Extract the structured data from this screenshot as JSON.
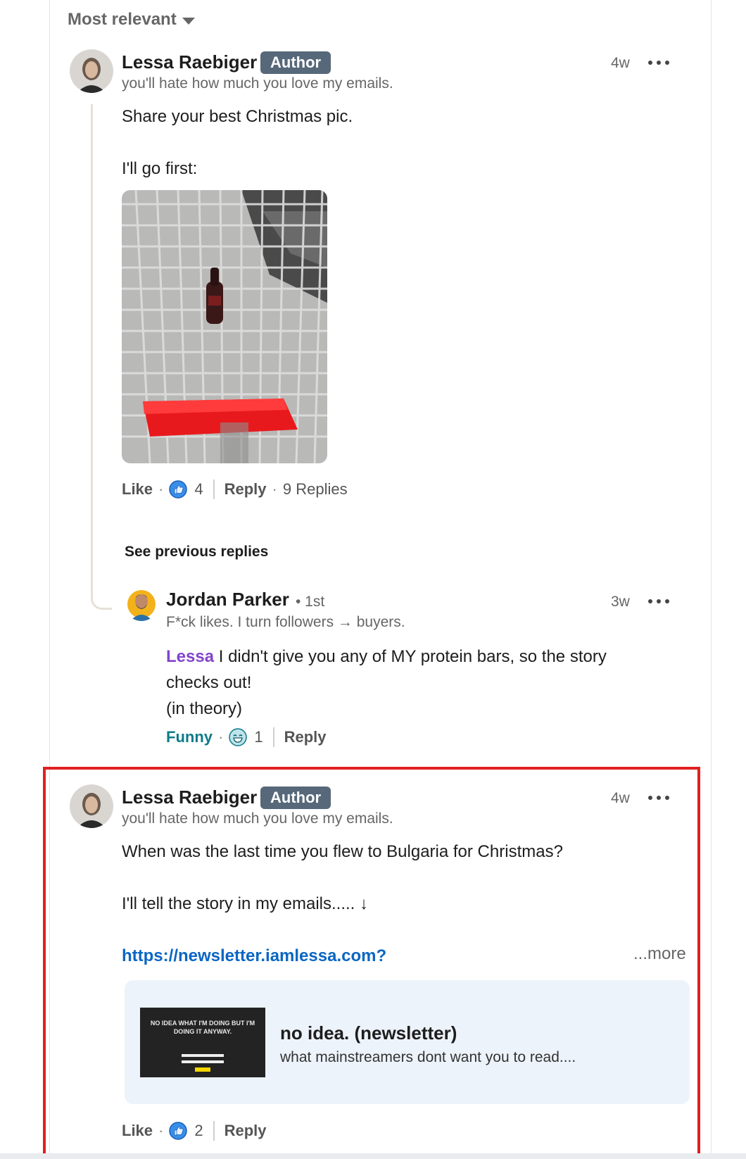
{
  "sort": {
    "label": "Most relevant"
  },
  "comment1": {
    "author": "Lessa Raebiger",
    "badge": "Author",
    "headline": "you'll hate how much you love my emails.",
    "time": "4w",
    "lines": [
      "Share your best Christmas pic.",
      "I'll go first:"
    ],
    "like_label": "Like",
    "reaction_count": "4",
    "reply_label": "Reply",
    "replies_label": "9 Replies"
  },
  "see_previous": "See previous replies",
  "reply1": {
    "author": "Jordan Parker",
    "degree": "• 1st",
    "headline": "F*ck likes. I turn followers → buyers.",
    "time": "3w",
    "mention": "Lessa",
    "text_line1": " I didn't give you any of MY protein bars, so the story",
    "text_line2": "checks out!",
    "text_line3": "(in theory)",
    "reaction_label": "Funny",
    "reaction_count": "1",
    "reply_label": "Reply"
  },
  "comment2": {
    "author": "Lessa Raebiger",
    "badge": "Author",
    "headline": "you'll hate how much you love my emails.",
    "time": "4w",
    "line1": "When was the last time you flew to Bulgaria for Christmas?",
    "line2": "I'll tell the story in my emails..... ↓",
    "link": "https://newsletter.iamlessa.com?",
    "more": "...more",
    "card": {
      "title": "no idea. (newsletter)",
      "subtitle": "what mainstreamers dont want you to read....",
      "thumb_text": "NO IDEA WHAT I'M DOING BUT I'M DOING IT ANYWAY."
    },
    "like_label": "Like",
    "reaction_count": "2",
    "reply_label": "Reply"
  },
  "colors": {
    "link": "#0a66c2",
    "mention": "#8344cc",
    "badge": "#56687a",
    "highlight": "#e02020",
    "funny": "#0e7a8a"
  }
}
